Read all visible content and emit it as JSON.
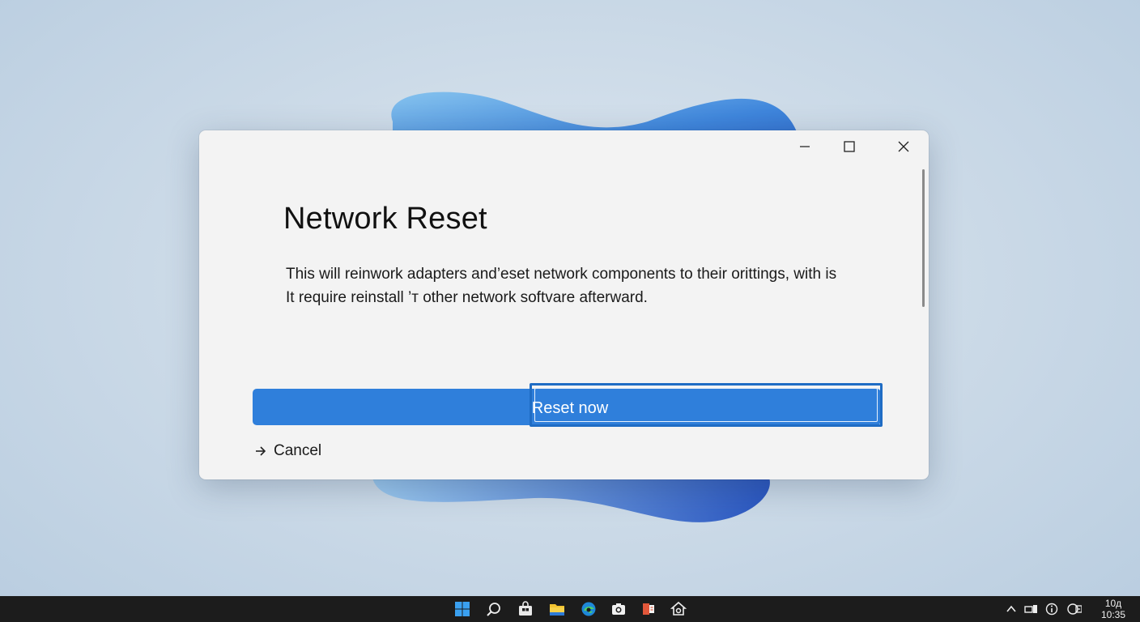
{
  "dialog": {
    "title": "Network Reset",
    "description_line1": "This will reinwork adapters and’eset network components to their orittings, with is",
    "description_line2": "It require reinstall ’т other network softvare afterward.",
    "primary_button_label": "Reset now",
    "cancel_label": "Cancel",
    "caption_buttons": [
      "minimize-icon",
      "maximize-icon",
      "close-icon"
    ]
  },
  "taskbar": {
    "pinned_icons": [
      "start-icon",
      "search-icon",
      "store-icon",
      "file-explorer-icon",
      "edge-icon",
      "camera-icon",
      "office-icon",
      "settings-icon"
    ],
    "tray_icons": [
      "chevron-up-icon",
      "network-icon",
      "info-icon",
      "language-icon"
    ],
    "clock_line1": "10д",
    "clock_line2": "10:35"
  },
  "colors": {
    "accent": "#2f7fdb",
    "focus_border": "#1f6cc4",
    "taskbar": "#1c1c1c"
  }
}
